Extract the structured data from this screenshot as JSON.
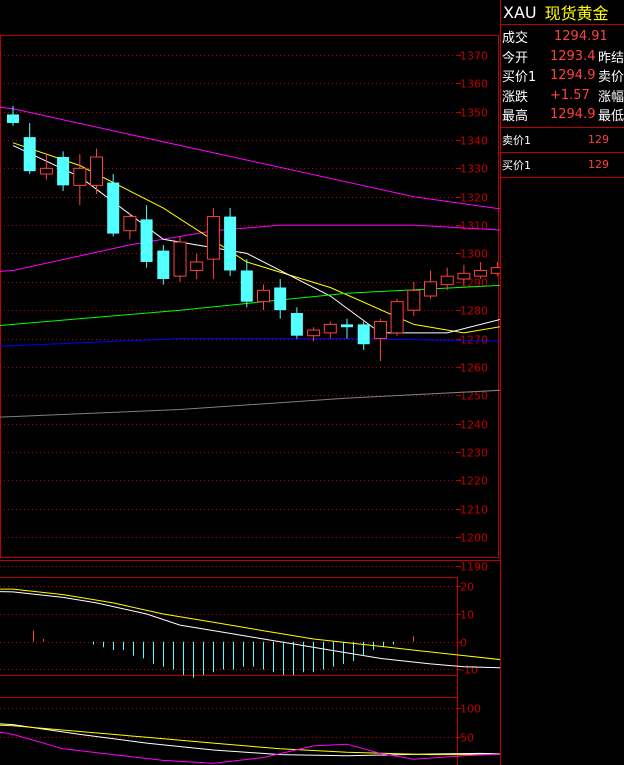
{
  "quote_panel": {
    "symbol": "XAU",
    "name": "现货黄金",
    "rows": [
      {
        "label": "成交",
        "value": "1294.91",
        "label2": ""
      },
      {
        "label": "今开",
        "value": "1293.4",
        "label2": "昨结"
      },
      {
        "label": "买价1",
        "value": "1294.9",
        "label2": "卖价"
      },
      {
        "label": "涨跌",
        "value": "+1.57",
        "label2": "涨幅"
      },
      {
        "label": "最高",
        "value": "1294.9",
        "label2": "最低"
      }
    ],
    "sell": {
      "label": "卖价1",
      "value": "129"
    },
    "buy": {
      "label": "买价1",
      "value": "129"
    }
  },
  "colors": {
    "frame": "#c00000",
    "grid": "#c00000",
    "bull": "#ff4040",
    "bear": "#54ffff",
    "axis_text": "#c00000"
  },
  "chart_data": [
    {
      "type": "candlestick",
      "ylim": [
        1193,
        1377
      ],
      "y_ticks": [
        1370,
        1360,
        1350,
        1340,
        1330,
        1320,
        1310,
        1300,
        1290,
        1280,
        1270,
        1260,
        1250,
        1240,
        1230,
        1220,
        1210,
        1200,
        1190
      ],
      "y_tick_labels": [
        "1370",
        "1360",
        "1350",
        "1340",
        "1330",
        "1320",
        "1310",
        "1300",
        "1290",
        "1280",
        "1270",
        "1260",
        "1250",
        "1240",
        "1230",
        "1220",
        "1210",
        "1200",
        "1190"
      ],
      "candles": [
        {
          "o": 1349,
          "h": 1352,
          "l": 1345,
          "c": 1346
        },
        {
          "o": 1341,
          "h": 1346,
          "l": 1328,
          "c": 1329
        },
        {
          "o": 1328,
          "h": 1335,
          "l": 1326,
          "c": 1330
        },
        {
          "o": 1334,
          "h": 1336,
          "l": 1322,
          "c": 1324
        },
        {
          "o": 1324,
          "h": 1335,
          "l": 1317,
          "c": 1330
        },
        {
          "o": 1324,
          "h": 1337,
          "l": 1321,
          "c": 1334
        },
        {
          "o": 1325,
          "h": 1328,
          "l": 1306,
          "c": 1307
        },
        {
          "o": 1308,
          "h": 1314,
          "l": 1305,
          "c": 1313
        },
        {
          "o": 1312,
          "h": 1317,
          "l": 1295,
          "c": 1297
        },
        {
          "o": 1301,
          "h": 1303,
          "l": 1289,
          "c": 1291
        },
        {
          "o": 1292,
          "h": 1306,
          "l": 1290,
          "c": 1304
        },
        {
          "o": 1294,
          "h": 1300,
          "l": 1291,
          "c": 1297
        },
        {
          "o": 1298,
          "h": 1316,
          "l": 1291,
          "c": 1313
        },
        {
          "o": 1313,
          "h": 1316,
          "l": 1292,
          "c": 1294
        },
        {
          "o": 1294,
          "h": 1298,
          "l": 1281,
          "c": 1283
        },
        {
          "o": 1283,
          "h": 1289,
          "l": 1280,
          "c": 1287
        },
        {
          "o": 1288,
          "h": 1291,
          "l": 1277,
          "c": 1280
        },
        {
          "o": 1279,
          "h": 1281,
          "l": 1270,
          "c": 1271
        },
        {
          "o": 1271,
          "h": 1274,
          "l": 1269,
          "c": 1273
        },
        {
          "o": 1272,
          "h": 1276,
          "l": 1270,
          "c": 1275
        },
        {
          "o": 1275,
          "h": 1277,
          "l": 1270,
          "c": 1274
        },
        {
          "o": 1275,
          "h": 1276,
          "l": 1266,
          "c": 1268
        },
        {
          "o": 1270,
          "h": 1277,
          "l": 1262,
          "c": 1276
        },
        {
          "o": 1272,
          "h": 1284,
          "l": 1271,
          "c": 1283
        },
        {
          "o": 1280,
          "h": 1290,
          "l": 1278,
          "c": 1287
        },
        {
          "o": 1285,
          "h": 1294,
          "l": 1284,
          "c": 1290
        },
        {
          "o": 1289,
          "h": 1295,
          "l": 1287,
          "c": 1292
        },
        {
          "o": 1291,
          "h": 1296,
          "l": 1289,
          "c": 1293
        },
        {
          "o": 1292,
          "h": 1297,
          "l": 1291,
          "c": 1294
        },
        {
          "o": 1293,
          "h": 1297,
          "l": 1292,
          "c": 1295
        }
      ],
      "lines": [
        {
          "color": "#ff00ff",
          "points": [
            [
              -10,
              1358
            ],
            [
              0,
              1351
            ],
            [
              24,
              1320
            ],
            [
              30,
              1315
            ],
            [
              33,
              1311
            ],
            [
              36,
              1309
            ],
            [
              40,
              1305
            ],
            [
              45,
              1298
            ],
            [
              50,
              1290
            ],
            [
              55,
              1280
            ],
            [
              60,
              1270
            ],
            [
              65,
              1262
            ]
          ]
        },
        {
          "color": "#ff00ff",
          "points": [
            [
              -10,
              1290
            ],
            [
              0,
              1294
            ],
            [
              7,
              1303
            ],
            [
              12,
              1308
            ],
            [
              16,
              1310
            ],
            [
              24,
              1310
            ],
            [
              30,
              1308
            ],
            [
              36,
              1306
            ],
            [
              40,
              1304
            ],
            [
              49,
              1303
            ]
          ]
        },
        {
          "color": "#ffff00",
          "points": [
            [
              0,
              1339
            ],
            [
              4,
              1331
            ],
            [
              9,
              1316
            ],
            [
              14,
              1297
            ],
            [
              19,
              1288
            ],
            [
              24,
              1275
            ],
            [
              27,
              1272
            ],
            [
              30,
              1275
            ],
            [
              35,
              1285
            ],
            [
              41,
              1284
            ]
          ]
        },
        {
          "color": "#ffffff",
          "points": [
            [
              0,
              1338
            ],
            [
              4,
              1327
            ],
            [
              9,
              1305
            ],
            [
              14,
              1300
            ],
            [
              19,
              1285
            ],
            [
              22,
              1272
            ],
            [
              26,
              1272
            ],
            [
              30,
              1278
            ],
            [
              33,
              1287
            ],
            [
              41,
              1291
            ]
          ]
        },
        {
          "color": "#00ff00",
          "points": [
            [
              -10,
              1270
            ],
            [
              0,
              1275
            ],
            [
              10,
              1280
            ],
            [
              20,
              1286
            ],
            [
              30,
              1289
            ],
            [
              35,
              1291
            ],
            [
              40,
              1293
            ]
          ]
        },
        {
          "color": "#0000ff",
          "points": [
            [
              -10,
              1265
            ],
            [
              10,
              1270
            ],
            [
              20,
              1270
            ],
            [
              30,
              1269
            ],
            [
              40,
              1269
            ]
          ]
        },
        {
          "color": "#808080",
          "points": [
            [
              -10,
              1240
            ],
            [
              10,
              1245
            ],
            [
              20,
              1249
            ],
            [
              30,
              1252
            ],
            [
              40,
              1255
            ]
          ]
        }
      ],
      "annotation_arrows": [
        {
          "color": "#ffffff",
          "points": [
            [
              41,
              1292
            ],
            [
              42.5,
              1302
            ]
          ]
        },
        {
          "color": "#ffffff",
          "points": [
            [
              43,
              1302
            ],
            [
              44.8,
              1293
            ]
          ]
        },
        {
          "color": "#ffffff",
          "points": [
            [
              45,
              1295
            ],
            [
              46.5,
              1309
            ]
          ]
        },
        {
          "color": "#ffffff",
          "points": [
            [
              47,
              1306
            ],
            [
              56,
              1269
            ]
          ]
        }
      ]
    },
    {
      "type": "bar+line",
      "ylim": [
        -12,
        23
      ],
      "y_ticks": [
        20,
        10,
        0,
        -10
      ],
      "y_tick_labels": [
        "20",
        "10",
        "0",
        "-10"
      ],
      "histogram": [
        0,
        0,
        4,
        1,
        0,
        0,
        0,
        0,
        -1,
        -2,
        -3,
        -3,
        -5,
        -6,
        -8,
        -9,
        -10,
        -12,
        -13,
        -12,
        -11,
        -10,
        -10,
        -9,
        -9,
        -10,
        -11,
        -12,
        -12,
        -11,
        -11,
        -10,
        -9,
        -8,
        -7,
        -5,
        -3,
        -2,
        -1,
        0,
        2
      ],
      "lines": [
        {
          "color": "#ffffff",
          "points": [
            [
              -10,
              19
            ],
            [
              0,
              18
            ],
            [
              3,
              16
            ],
            [
              5,
              14
            ],
            [
              8,
              10
            ],
            [
              10,
              6
            ],
            [
              13,
              3
            ],
            [
              15,
              1
            ],
            [
              17,
              -1
            ],
            [
              19,
              -3
            ],
            [
              22,
              -6
            ],
            [
              25,
              -8
            ],
            [
              27,
              -9
            ],
            [
              30,
              -9.5
            ],
            [
              32,
              -9
            ],
            [
              34,
              -8
            ],
            [
              36,
              -6
            ],
            [
              38,
              -5
            ],
            [
              41,
              -4
            ]
          ]
        },
        {
          "color": "#ffff00",
          "points": [
            [
              -10,
              19
            ],
            [
              0,
              19
            ],
            [
              3,
              17
            ],
            [
              6,
              14
            ],
            [
              9,
              10
            ],
            [
              12,
              7
            ],
            [
              15,
              4
            ],
            [
              18,
              1
            ],
            [
              21,
              -1
            ],
            [
              24,
              -3
            ],
            [
              27,
              -5
            ],
            [
              30,
              -7
            ],
            [
              32,
              -8
            ],
            [
              34,
              -7
            ],
            [
              37,
              -5.5
            ],
            [
              41,
              -4
            ]
          ]
        }
      ]
    },
    {
      "type": "line",
      "ylim": [
        2,
        118
      ],
      "y_ticks": [
        100,
        50
      ],
      "y_tick_labels": [
        "100",
        "50"
      ],
      "lines": [
        {
          "color": "#ffffff",
          "points": [
            [
              -10,
              80
            ],
            [
              -5,
              80
            ],
            [
              0,
              72
            ],
            [
              4,
              55
            ],
            [
              8,
              40
            ],
            [
              12,
              28
            ],
            [
              16,
              20
            ],
            [
              20,
              18
            ],
            [
              25,
              21
            ],
            [
              28,
              22
            ],
            [
              31,
              20
            ],
            [
              33,
              25
            ],
            [
              35,
              45
            ],
            [
              37,
              65
            ],
            [
              39,
              78
            ],
            [
              41,
              85
            ]
          ]
        },
        {
          "color": "#ffff00",
          "points": [
            [
              -10,
              80
            ],
            [
              -5,
              75
            ],
            [
              0,
              70
            ],
            [
              4,
              60
            ],
            [
              8,
              50
            ],
            [
              12,
              40
            ],
            [
              16,
              30
            ],
            [
              20,
              24
            ],
            [
              25,
              20
            ],
            [
              28,
              20
            ],
            [
              31,
              21
            ],
            [
              33,
              24
            ],
            [
              35,
              35
            ],
            [
              37,
              50
            ],
            [
              39,
              62
            ],
            [
              41,
              70
            ]
          ]
        },
        {
          "color": "#ff00ff",
          "points": [
            [
              -10,
              88
            ],
            [
              -7,
              80
            ],
            [
              -3,
              70
            ],
            [
              0,
              55
            ],
            [
              3,
              30
            ],
            [
              6,
              20
            ],
            [
              9,
              10
            ],
            [
              12,
              5
            ],
            [
              15,
              15
            ],
            [
              18,
              35
            ],
            [
              20,
              38
            ],
            [
              22,
              22
            ],
            [
              24,
              12
            ],
            [
              27,
              18
            ],
            [
              30,
              22
            ],
            [
              31,
              20
            ],
            [
              33,
              40
            ],
            [
              35,
              65
            ],
            [
              37,
              90
            ],
            [
              39,
              105
            ],
            [
              41,
              110
            ]
          ]
        }
      ]
    }
  ]
}
